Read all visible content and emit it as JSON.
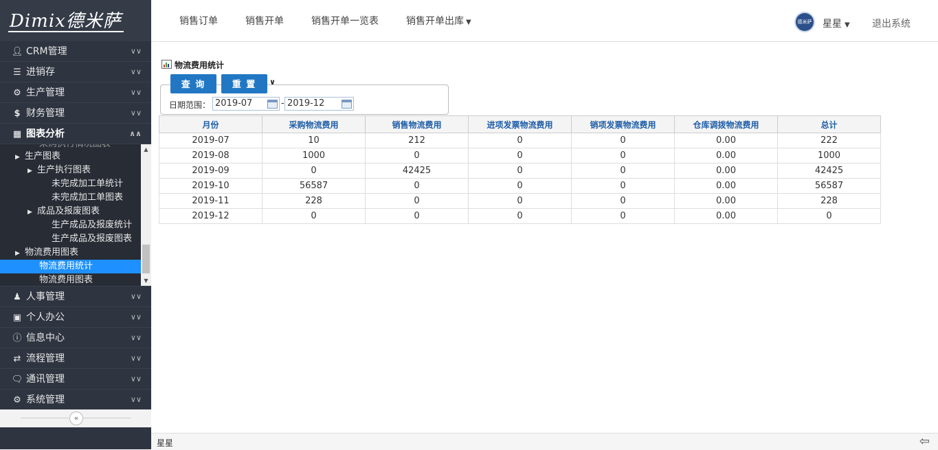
{
  "brand": {
    "logo_text": "Dimix德米萨",
    "avatar_text": "德米萨"
  },
  "sidebar": {
    "menus_top": [
      {
        "label": "CRM管理",
        "icon": "user-icon"
      },
      {
        "label": "进销存",
        "icon": "list-icon"
      },
      {
        "label": "生产管理",
        "icon": "gears-icon"
      },
      {
        "label": "财务管理",
        "icon": "dollar-icon"
      },
      {
        "label": "图表分析",
        "icon": "chart-icon"
      }
    ],
    "submenu": {
      "partial_label": "采购执行情况图表",
      "items": [
        {
          "label": "生产图表",
          "level": "l1"
        },
        {
          "label": "生产执行图表",
          "level": "l2"
        },
        {
          "label": "未完成加工单统计",
          "level": "l3"
        },
        {
          "label": "未完成加工单图表",
          "level": "l3"
        },
        {
          "label": "成品及报废图表",
          "level": "l2"
        },
        {
          "label": "生产成品及报废统计",
          "level": "l3"
        },
        {
          "label": "生产成品及报废图表",
          "level": "l3"
        },
        {
          "label": "物流费用图表",
          "level": "l1"
        },
        {
          "label": "物流费用统计",
          "level": "l2b"
        },
        {
          "label": "物流费用图表",
          "level": "l2b"
        }
      ]
    },
    "menus_bottom": [
      {
        "label": "人事管理",
        "icon": "people-icon"
      },
      {
        "label": "个人办公",
        "icon": "briefcase-icon"
      },
      {
        "label": "信息中心",
        "icon": "info-icon"
      },
      {
        "label": "流程管理",
        "icon": "exchange-icon"
      },
      {
        "label": "通讯管理",
        "icon": "chat-icon"
      },
      {
        "label": "系统管理",
        "icon": "cog-icon"
      }
    ]
  },
  "header": {
    "nav": [
      "销售订单",
      "销售开单",
      "销售开单一览表",
      "销售开单出库"
    ],
    "username": "星星",
    "logout": "退出系统"
  },
  "page": {
    "title": "物流费用统计",
    "query_button": "查 询",
    "reset_button": "重 置",
    "date_label": "日期范围：",
    "date_from": "2019-07",
    "date_sep": "-",
    "date_to": "2019-12"
  },
  "table": {
    "headers": [
      "月份",
      "采购物流费用",
      "销售物流费用",
      "进项发票物流费用",
      "销项发票物流费用",
      "仓库调拨物流费用",
      "总计"
    ],
    "rows": [
      [
        "2019-07",
        "10",
        "212",
        "0",
        "0",
        "0.00",
        "222"
      ],
      [
        "2019-08",
        "1000",
        "0",
        "0",
        "0",
        "0.00",
        "1000"
      ],
      [
        "2019-09",
        "0",
        "42425",
        "0",
        "0",
        "0.00",
        "42425"
      ],
      [
        "2019-10",
        "56587",
        "0",
        "0",
        "0",
        "0.00",
        "56587"
      ],
      [
        "2019-11",
        "228",
        "0",
        "0",
        "0",
        "0.00",
        "228"
      ],
      [
        "2019-12",
        "0",
        "0",
        "0",
        "0",
        "0.00",
        "0"
      ]
    ]
  },
  "footer": {
    "user": "星星"
  },
  "colors": {
    "accent": "#2277c4",
    "selected": "#1e90ff",
    "sidebar_bg": "#2e3440"
  }
}
